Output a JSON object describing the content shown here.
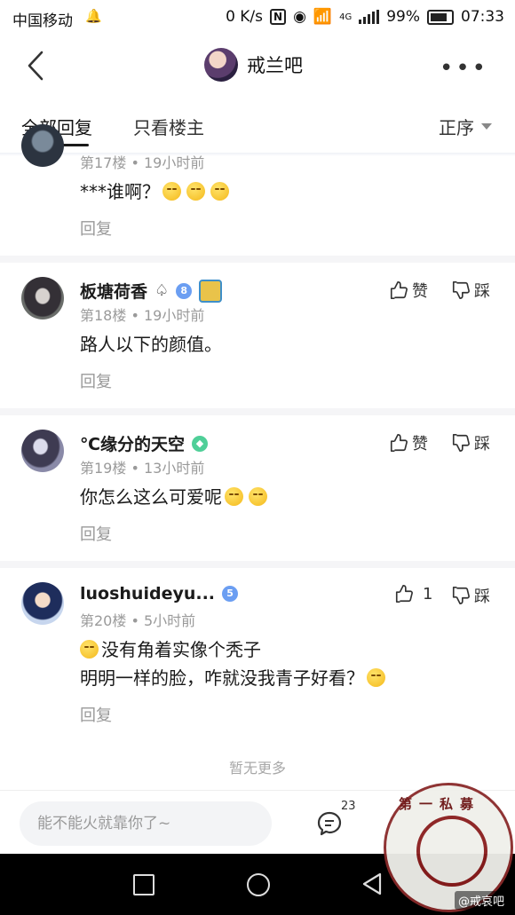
{
  "status_bar": {
    "carrier": "中国移动",
    "speed": "0 K/s",
    "network": "4G",
    "battery": "99%",
    "time": "07:33"
  },
  "header": {
    "forum_name": "戒兰吧"
  },
  "tabs": {
    "all_replies": "全部回复",
    "owner_only": "只看楼主",
    "sort": "正序"
  },
  "comments": [
    {
      "username": "",
      "floor": "第17楼",
      "time": "19小时前",
      "text": "***谁啊？",
      "reply": "回复"
    },
    {
      "username": "板塘荷香",
      "suffix_icon": "♤",
      "level_badge": "8",
      "floor": "第18楼",
      "time": "19小时前",
      "text": "路人以下的颜值。",
      "like_label": "赞",
      "dislike_label": "踩",
      "reply": "回复"
    },
    {
      "username": "℃缘分的天空",
      "floor": "第19楼",
      "time": "13小时前",
      "text": "你怎么这么可爱呢",
      "like_label": "赞",
      "dislike_label": "踩",
      "reply": "回复"
    },
    {
      "username": "luoshuideyu...",
      "level_badge": "5",
      "floor": "第20楼",
      "time": "5小时前",
      "text_line1": "没有角着实像个秃子",
      "text_line2": "明明一样的脸，咋就没我青子好看？",
      "like_count": "1",
      "dislike_label": "踩",
      "reply": "回复"
    }
  ],
  "no_more": "暂无更多",
  "input_bar": {
    "placeholder": "能不能火就靠你了~",
    "comment_count": "23"
  },
  "watermark": {
    "text": "第一私募",
    "credit": "@戒哀吧"
  },
  "colors": {
    "accent_underline": "#1a1a1a",
    "meta_gray": "#9a9a9a",
    "badge_blue": "#6b9ef2",
    "badge_green": "#4fcf98"
  }
}
